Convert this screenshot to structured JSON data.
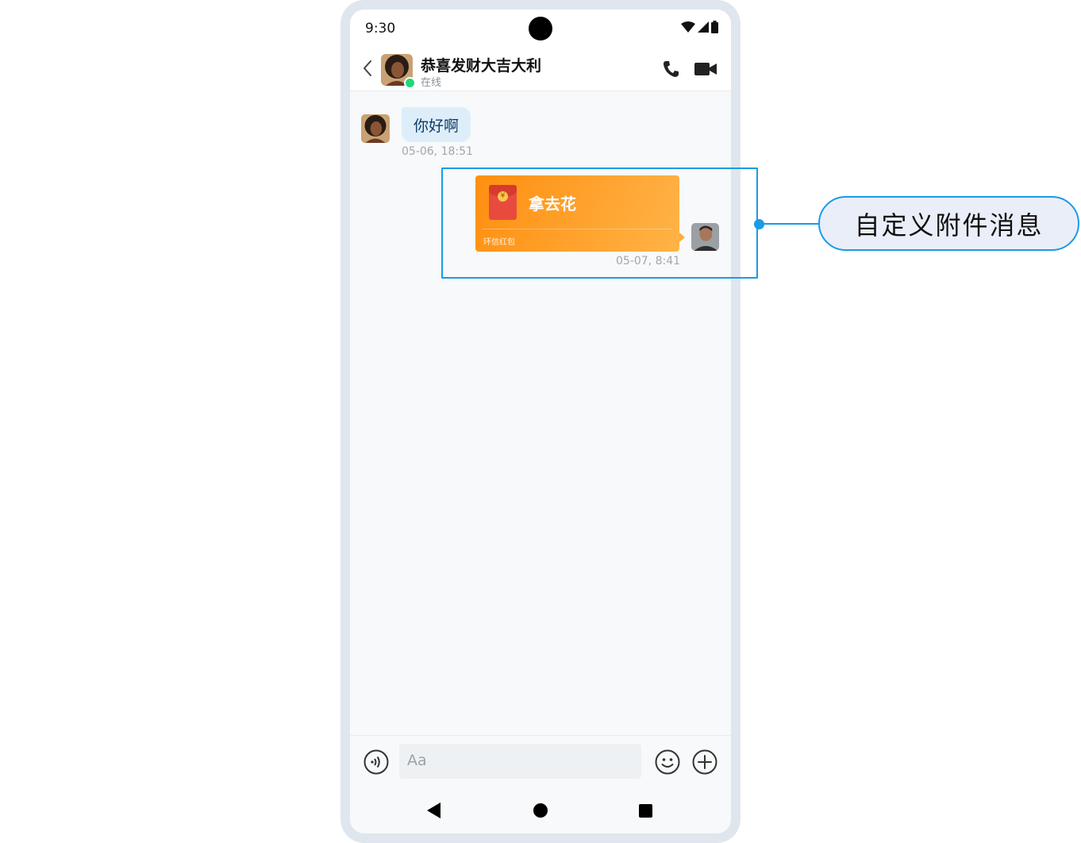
{
  "status_bar": {
    "time": "9:30"
  },
  "header": {
    "title": "恭喜发财大吉大利",
    "status": "在线"
  },
  "messages": [
    {
      "direction": "incoming",
      "text": "你好啊",
      "time": "05-06, 18:51"
    },
    {
      "direction": "outgoing",
      "type": "red-packet",
      "title": "拿去花",
      "label": "环信红包",
      "time": "05-07, 8:41"
    }
  ],
  "composer": {
    "placeholder": "Aa"
  },
  "annotation": {
    "label": "自定义附件消息"
  },
  "colors": {
    "accent": "#1a9be6",
    "red_packet": "#ff9a1f",
    "incoming_bubble": "#ddeefa"
  }
}
